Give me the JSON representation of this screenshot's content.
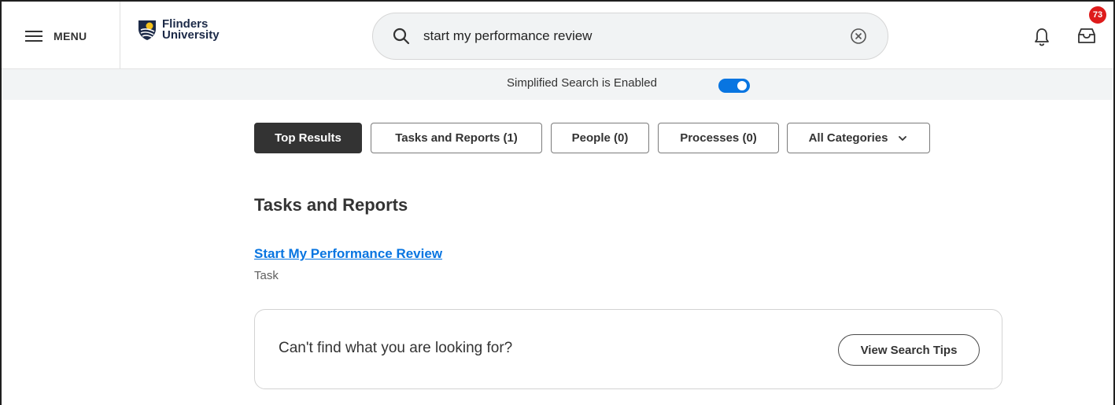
{
  "header": {
    "menu_label": "MENU",
    "logo_line1": "Flinders",
    "logo_line2": "University",
    "search_value": "start my performance review",
    "notifications_icon": "bell-icon",
    "inbox_icon": "inbox-icon",
    "inbox_badge": "73",
    "badge_color": "#de1b1b"
  },
  "simplified": {
    "label": "Simplified Search is Enabled",
    "toggle_on": true,
    "toggle_color": "#0875e1"
  },
  "filters": {
    "top_results": "Top Results",
    "tasks_reports": "Tasks and Reports (1)",
    "people": "People (0)",
    "processes": "Processes (0)",
    "all_categories": "All Categories"
  },
  "results": {
    "section_title": "Tasks and Reports",
    "items": [
      {
        "title": "Start My Performance Review",
        "type": "Task"
      }
    ]
  },
  "tips": {
    "prompt": "Can't find what you are looking for?",
    "button_label": "View Search Tips"
  },
  "colors": {
    "accent": "#0875e1",
    "active_filter": "#333333"
  }
}
